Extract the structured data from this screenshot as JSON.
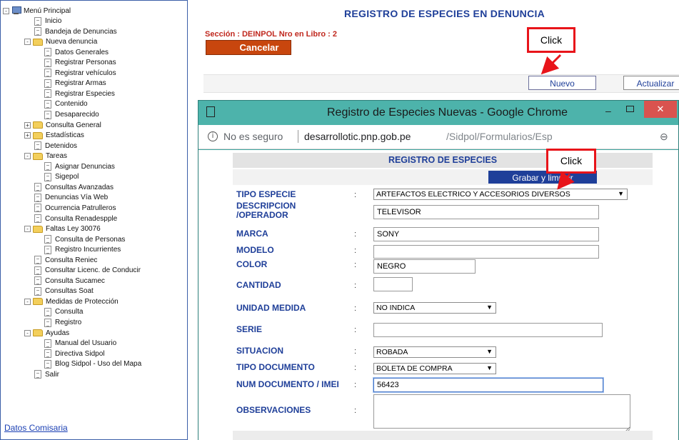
{
  "sidebar": {
    "items": [
      {
        "label": "Menú Principal",
        "level": 0,
        "icon": "computer-icon",
        "toggle": "-"
      },
      {
        "label": "Inicio",
        "level": 1,
        "icon": "page-icon"
      },
      {
        "label": "Bandeja de Denuncias",
        "level": 1,
        "icon": "page-icon"
      },
      {
        "label": "Nueva denuncia",
        "level": 1,
        "icon": "folder-icon",
        "toggle": "-"
      },
      {
        "label": "Datos Generales",
        "level": 2,
        "icon": "page-icon"
      },
      {
        "label": "Registrar Personas",
        "level": 2,
        "icon": "page-icon"
      },
      {
        "label": "Registrar vehículos",
        "level": 2,
        "icon": "page-icon"
      },
      {
        "label": "Registrar Armas",
        "level": 2,
        "icon": "page-icon"
      },
      {
        "label": "Registrar Especies",
        "level": 2,
        "icon": "page-icon"
      },
      {
        "label": "Contenido",
        "level": 2,
        "icon": "page-icon"
      },
      {
        "label": "Desaparecido",
        "level": 2,
        "icon": "page-icon"
      },
      {
        "label": "Consulta General",
        "level": 1,
        "icon": "folder-icon",
        "toggle": "+"
      },
      {
        "label": "Estadísticas",
        "level": 1,
        "icon": "folder-icon",
        "toggle": "+"
      },
      {
        "label": "Detenidos",
        "level": 1,
        "icon": "page-icon"
      },
      {
        "label": "Tareas",
        "level": 1,
        "icon": "folder-icon",
        "toggle": "-"
      },
      {
        "label": "Asignar Denuncias",
        "level": 2,
        "icon": "page-icon"
      },
      {
        "label": "Sigepol",
        "level": 2,
        "icon": "page-icon"
      },
      {
        "label": "Consultas Avanzadas",
        "level": 1,
        "icon": "page-icon"
      },
      {
        "label": "Denuncias Vía Web",
        "level": 1,
        "icon": "page-icon"
      },
      {
        "label": "Ocurrencia Patrulleros",
        "level": 1,
        "icon": "page-icon"
      },
      {
        "label": "Consulta Renadespple",
        "level": 1,
        "icon": "page-icon"
      },
      {
        "label": "Faltas Ley 30076",
        "level": 1,
        "icon": "folder-icon",
        "toggle": "-"
      },
      {
        "label": "Consulta de Personas",
        "level": 2,
        "icon": "page-icon"
      },
      {
        "label": "Registro Incurrientes",
        "level": 2,
        "icon": "page-icon"
      },
      {
        "label": "Consulta Reniec",
        "level": 1,
        "icon": "page-icon"
      },
      {
        "label": "Consultar Licenc. de Conducir",
        "level": 1,
        "icon": "page-icon"
      },
      {
        "label": "Consulta Sucamec",
        "level": 1,
        "icon": "page-icon"
      },
      {
        "label": "Consultas Soat",
        "level": 1,
        "icon": "page-icon"
      },
      {
        "label": "Medidas de Protección",
        "level": 1,
        "icon": "folder-icon",
        "toggle": "-"
      },
      {
        "label": "Consulta",
        "level": 2,
        "icon": "page-icon"
      },
      {
        "label": "Registro",
        "level": 2,
        "icon": "page-icon"
      },
      {
        "label": "Ayudas",
        "level": 1,
        "icon": "folder-icon",
        "toggle": "-"
      },
      {
        "label": "Manual del Usuario",
        "level": 2,
        "icon": "page-icon"
      },
      {
        "label": "Directiva Sidpol",
        "level": 2,
        "icon": "page-icon"
      },
      {
        "label": "Blog Sidpol - Uso del Mapa",
        "level": 2,
        "icon": "page-icon"
      },
      {
        "label": "Salir",
        "level": 1,
        "icon": "page-icon"
      }
    ],
    "footer_link": "Datos Comisaria"
  },
  "main": {
    "title": "REGISTRO  DE  ESPECIES EN DENUNCIA",
    "section": "Sección : DEINPOL Nro en Libro : 2",
    "cancel_label": "Cancelar",
    "nuevo_label": "Nuevo",
    "actualizar_label": "Actualizar"
  },
  "callouts": {
    "first": "Click",
    "second": "Click"
  },
  "popup": {
    "window_title": "Registro de Especies Nuevas - Google Chrome",
    "security_text": "No es seguro",
    "url_host": "desarrollotic.pnp.gob.pe",
    "url_path": "/Sidpol/Formularios/Esp",
    "minimize": "–",
    "close": "✕",
    "zoom_glyph": "⊖",
    "info_glyph": "i",
    "form": {
      "header": "REGISTRO DE ESPECIES",
      "save_label": "Grabar y limpiar",
      "colon": ":",
      "fields": {
        "tipo_especie": {
          "label": "TIPO ESPECIE",
          "value": "ARTEFACTOS ELECTRICO Y ACCESORIOS DIVERSOS"
        },
        "descripcion": {
          "label_line1": "DESCRIPCION",
          "label_line2": "/OPERADOR",
          "value": "TELEVISOR"
        },
        "marca": {
          "label": "MARCA",
          "value": "SONY"
        },
        "modelo": {
          "label": "MODELO",
          "value": ""
        },
        "color": {
          "label": "COLOR",
          "value": "NEGRO"
        },
        "cantidad": {
          "label": "CANTIDAD",
          "value": ""
        },
        "unidad_medida": {
          "label": "UNIDAD MEDIDA",
          "value": "NO INDICA"
        },
        "serie": {
          "label": "SERIE",
          "value": ""
        },
        "situacion": {
          "label": "SITUACION",
          "value": "ROBADA"
        },
        "tipo_documento": {
          "label": "TIPO DOCUMENTO",
          "value": "BOLETA DE COMPRA"
        },
        "num_documento": {
          "label": "NUM DOCUMENTO / IMEI",
          "value": "56423"
        },
        "observaciones": {
          "label": "OBSERVACIONES",
          "value": ""
        }
      }
    }
  },
  "colors": {
    "brand_blue": "#1f3f99",
    "callout_red": "#e8141a",
    "cancel_orange": "#c8460e",
    "window_teal": "#4db3ab"
  }
}
